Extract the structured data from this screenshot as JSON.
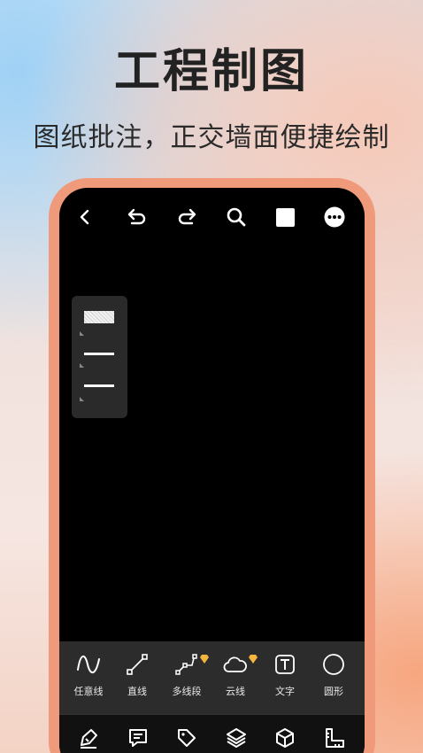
{
  "promo": {
    "title": "工程制图",
    "subtitle": "图纸批注，正交墙面便捷绘制"
  },
  "toolbar": {
    "icons": [
      "back-icon",
      "undo-icon",
      "redo-icon",
      "search-icon",
      "square-icon",
      "more-icon"
    ]
  },
  "layers_panel": {
    "items": [
      "layer-hatched",
      "layer-line",
      "layer-line"
    ]
  },
  "tools": [
    {
      "label": "任意线",
      "icon": "freehand-icon",
      "premium": false
    },
    {
      "label": "直线",
      "icon": "line-icon",
      "premium": false
    },
    {
      "label": "多线段",
      "icon": "polyline-icon",
      "premium": true
    },
    {
      "label": "云线",
      "icon": "cloud-icon",
      "premium": true
    },
    {
      "label": "文字",
      "icon": "text-icon",
      "premium": false
    },
    {
      "label": "圆形",
      "icon": "circle-icon",
      "premium": false
    }
  ],
  "bottom_nav": {
    "items": [
      "draw-icon",
      "comment-icon",
      "tag-icon",
      "layers-icon",
      "cube-icon",
      "ruler-icon"
    ],
    "active": "draw-icon"
  },
  "colors": {
    "accent": "#f09a7c",
    "badge": "#f4b53f"
  }
}
